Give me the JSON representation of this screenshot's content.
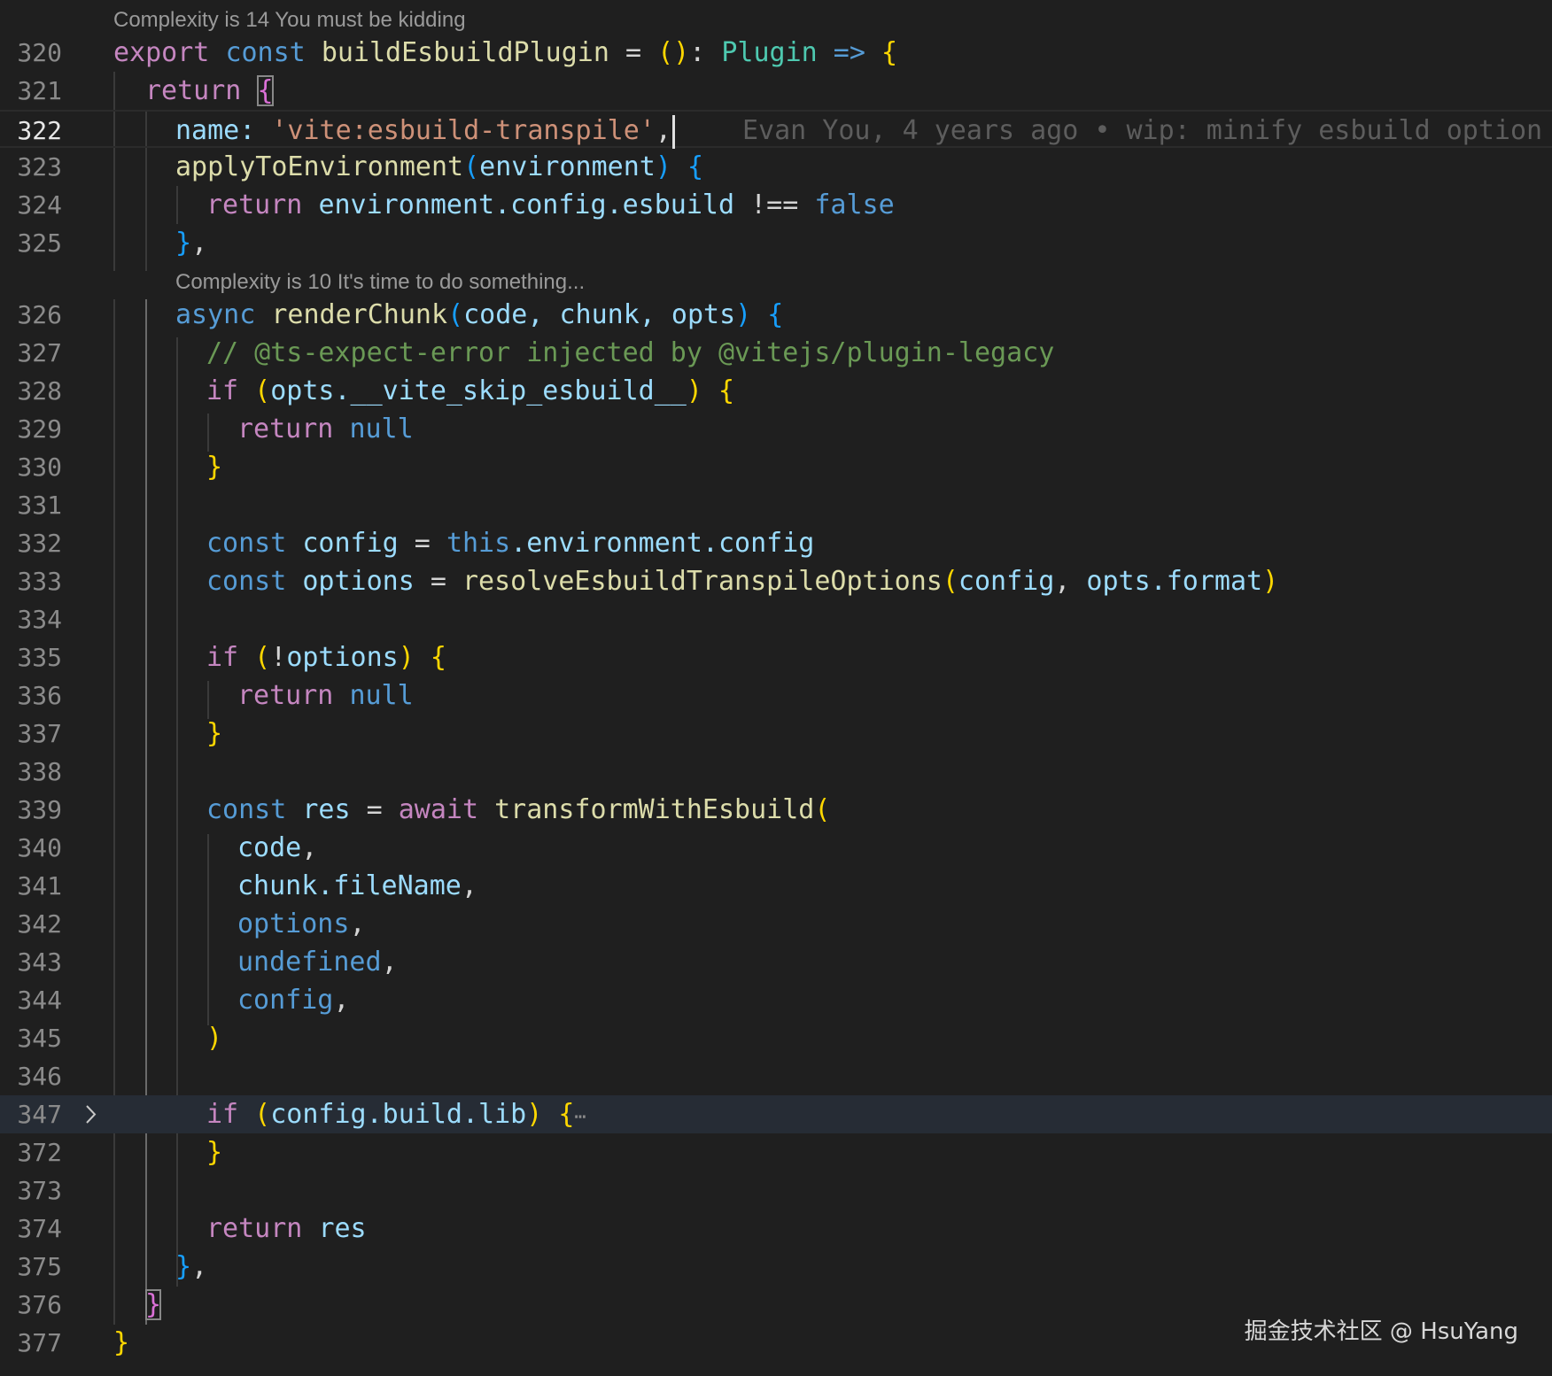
{
  "codelens": {
    "line320": "Complexity is 14 You must be kidding",
    "line326": "Complexity is 10 It's time to do something..."
  },
  "blame": {
    "line322": "Evan You, 4 years ago • wip: minify esbuild option"
  },
  "line_numbers": [
    "320",
    "321",
    "322",
    "323",
    "324",
    "325",
    "326",
    "327",
    "328",
    "329",
    "330",
    "331",
    "332",
    "333",
    "334",
    "335",
    "336",
    "337",
    "338",
    "339",
    "340",
    "341",
    "342",
    "343",
    "344",
    "345",
    "346",
    "347",
    "372",
    "373",
    "374",
    "375",
    "376",
    "377"
  ],
  "code": {
    "l320": {
      "export": "export",
      "const": "const",
      "name": "buildEsbuildPlugin",
      "eq": " = ",
      "open": "()",
      "colon": ": ",
      "type": "Plugin",
      "arrow": " => ",
      "brace": "{"
    },
    "l321": {
      "ret": "return",
      "brace": "{"
    },
    "l322": {
      "key": "name:",
      "str": "'vite:esbuild-transpile'",
      "comma": ","
    },
    "l323": {
      "fn": "applyToEnvironment",
      "lp": "(",
      "arg": "environment",
      "rp": ")",
      "brace": " {"
    },
    "l324": {
      "ret": "return",
      "expr": "environment.config.esbuild",
      "op": " !== ",
      "val": "false"
    },
    "l325": {
      "brace": "}",
      "comma": ","
    },
    "l326": {
      "async": "async",
      "fn": "renderChunk",
      "lp": "(",
      "args": "code, chunk, opts",
      "rp": ")",
      "brace": " {"
    },
    "l327": {
      "comment": "// @ts-expect-error injected by @vitejs/plugin-legacy"
    },
    "l328": {
      "if": "if",
      "lp": " (",
      "expr": "opts.__vite_skip_esbuild__",
      "rp": ")",
      "brace": " {"
    },
    "l329": {
      "ret": "return",
      "val": "null"
    },
    "l330": {
      "brace": "}"
    },
    "l332": {
      "const": "const",
      "name": "config",
      "eq": " = ",
      "this": "this",
      "rest": ".environment.config"
    },
    "l333": {
      "const": "const",
      "name": "options",
      "eq": " = ",
      "fn": "resolveEsbuildTranspileOptions",
      "lp": "(",
      "a1": "config",
      "sep": ", ",
      "a2": "opts.format",
      "rp": ")"
    },
    "l335": {
      "if": "if",
      "lp": " (",
      "not": "!",
      "expr": "options",
      "rp": ")",
      "brace": " {"
    },
    "l336": {
      "ret": "return",
      "val": "null"
    },
    "l337": {
      "brace": "}"
    },
    "l339": {
      "const": "const",
      "name": "res",
      "eq": " = ",
      "await": "await",
      "fn": "transformWithEsbuild",
      "lp": "("
    },
    "l340": {
      "text": "code",
      "comma": ","
    },
    "l341": {
      "text": "chunk.fileName",
      "comma": ","
    },
    "l342": {
      "text": "options",
      "comma": ","
    },
    "l343": {
      "text": "undefined",
      "comma": ","
    },
    "l344": {
      "text": "config",
      "comma": ","
    },
    "l345": {
      "rp": ")"
    },
    "l347": {
      "if": "if",
      "lp": " (",
      "expr": "config.build.lib",
      "rp": ")",
      "brace": " {",
      "ellipsis": "⋯"
    },
    "l372": {
      "brace": "}"
    },
    "l374": {
      "ret": "return",
      "val": "res"
    },
    "l375": {
      "brace": "}",
      "comma": ","
    },
    "l376": {
      "brace": "}"
    },
    "l377": {
      "brace": "}"
    }
  },
  "watermark": "掘金技术社区 @ HsuYang",
  "colors": {
    "background": "#1f1f1f",
    "keyword": "#c586c0",
    "storage": "#569cd6",
    "function": "#dcdcaa",
    "type": "#4ec9b0",
    "variable": "#9cdcfe",
    "string": "#ce9178",
    "comment": "#6a9955",
    "bracket_gold": "#ffd700"
  }
}
